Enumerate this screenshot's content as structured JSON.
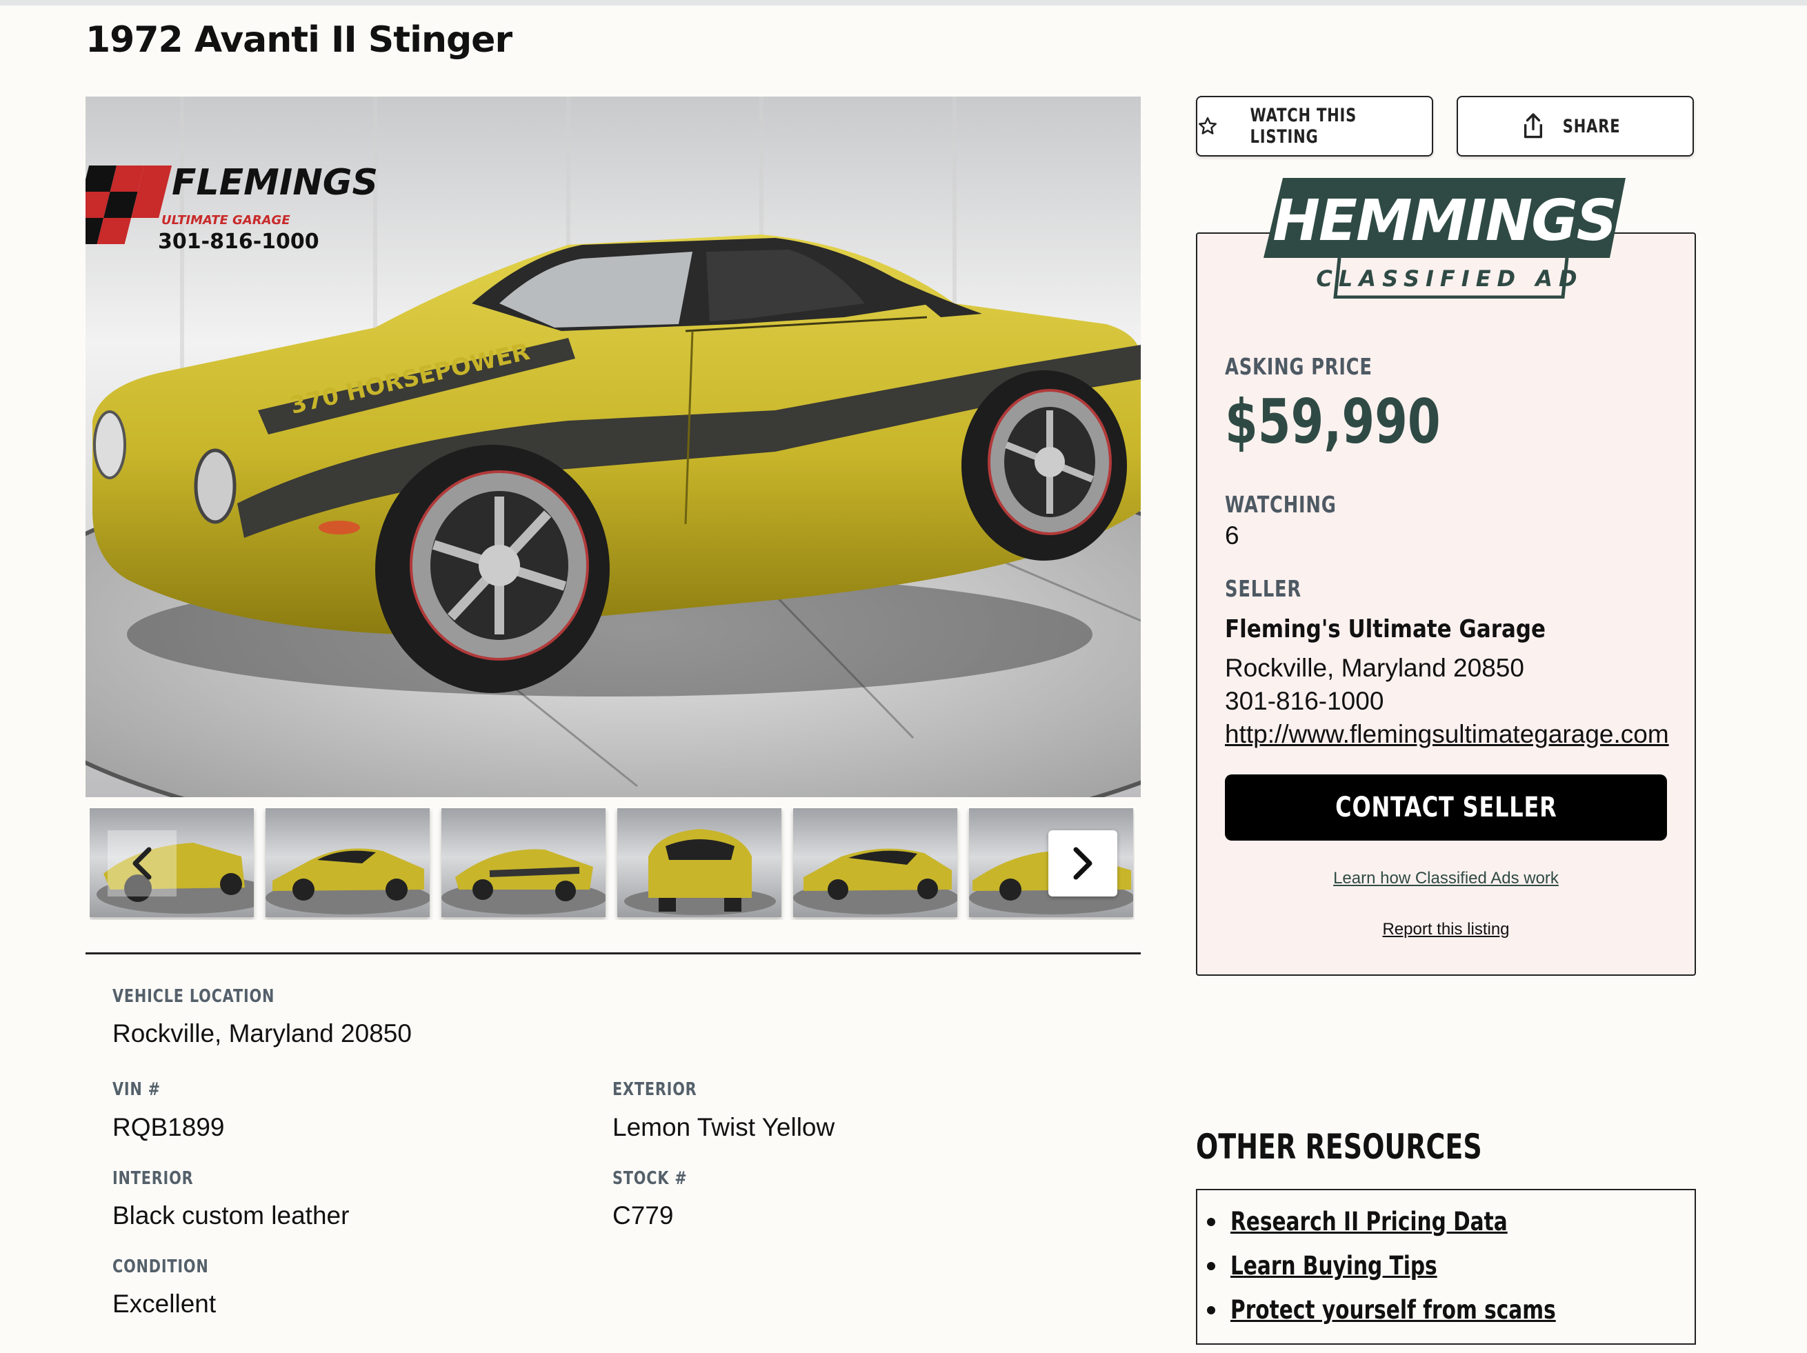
{
  "listing": {
    "title": "1972 Avanti II Stinger",
    "watermark": {
      "brand": "FLEMINGS",
      "sub": "ULTIMATE GARAGE",
      "phone": "301-816-1000"
    },
    "hood_stripe_text": "370 HORSEPOWER"
  },
  "gallery": {
    "thumb_count": 6,
    "prev_icon": "chevron-left-icon",
    "next_icon": "chevron-right-icon"
  },
  "details": {
    "location_label": "VEHICLE LOCATION",
    "location_value": "Rockville, Maryland 20850",
    "vin_label": "VIN #",
    "vin_value": "RQB1899",
    "exterior_label": "EXTERIOR",
    "exterior_value": "Lemon Twist Yellow",
    "interior_label": "INTERIOR",
    "interior_value": "Black custom leather",
    "stock_label": "STOCK #",
    "stock_value": "C779",
    "condition_label": "CONDITION",
    "condition_value": "Excellent"
  },
  "actions": {
    "watch_label": "WATCH THIS LISTING",
    "watch_icon": "star-icon",
    "share_label": "SHARE",
    "share_icon": "share-icon"
  },
  "panel": {
    "logo_text": "HEMMINGS",
    "logo_sub": "CLASSIFIED AD",
    "asking_label": "ASKING PRICE",
    "asking_value": "$59,990",
    "watching_label": "WATCHING",
    "watching_value": "6",
    "seller_label": "SELLER",
    "seller_name": "Fleming's Ultimate Garage",
    "seller_location": "Rockville, Maryland 20850",
    "seller_phone": "301-816-1000",
    "seller_url": "http://www.flemingsultimategarage.com",
    "contact_label": "CONTACT SELLER",
    "learn_link": "Learn how Classified Ads work",
    "report_link": "Report this listing"
  },
  "resources": {
    "title": "OTHER RESOURCES",
    "items": [
      "Research II Pricing Data",
      "Learn Buying Tips",
      "Protect yourself from scams"
    ]
  },
  "colors": {
    "car_yellow": "#c8b52a",
    "hemmings_green": "#2f4a44",
    "panel_bg": "#fbf1ef",
    "page_bg": "#fcfbf8"
  }
}
